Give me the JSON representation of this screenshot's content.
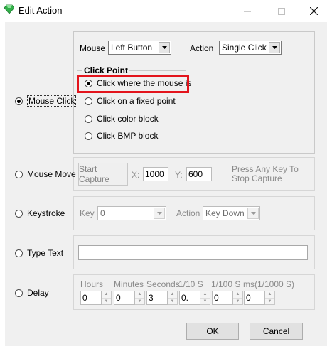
{
  "window": {
    "title": "Edit Action",
    "icon": "green-gem-icon",
    "controls": [
      "minimize-icon",
      "maximize-icon",
      "close-icon"
    ]
  },
  "accent": {
    "highlight_border": "#e3141c",
    "icon_color": "#33b04a"
  },
  "mouse_click": {
    "label": "Mouse Click",
    "checked": true,
    "mouse_label": "Mouse",
    "mouse_value": "Left Button",
    "action_label": "Action",
    "action_value": "Single Click",
    "click_point": {
      "title": "Click Point",
      "options": [
        {
          "label": "Click where the mouse is",
          "checked": true
        },
        {
          "label": "Click on a fixed point",
          "checked": false
        },
        {
          "label": "Click color block",
          "checked": false
        },
        {
          "label": "Click BMP block",
          "checked": false
        }
      ]
    }
  },
  "mouse_move": {
    "label": "Mouse Move",
    "checked": false,
    "start_capture": "Start Capture",
    "x_label": "X:",
    "x_value": "1000",
    "y_label": "Y:",
    "y_value": "600",
    "hint_line1": "Press Any Key To",
    "hint_line2": "Stop Capture"
  },
  "keystroke": {
    "label": "Keystroke",
    "checked": false,
    "key_label": "Key",
    "key_value": "0",
    "action_label": "Action",
    "action_value": "Key Down"
  },
  "type_text": {
    "label": "Type Text",
    "checked": false,
    "value": ""
  },
  "delay": {
    "label": "Delay",
    "checked": false,
    "headers": [
      "Hours",
      "Minutes",
      "Seconds",
      "1/10 S",
      "1/100 S",
      "ms(1/1000 S)"
    ],
    "values": [
      "0",
      "0",
      "3",
      "0.",
      "0",
      "0"
    ]
  },
  "buttons": {
    "ok": "OK",
    "cancel": "Cancel"
  }
}
